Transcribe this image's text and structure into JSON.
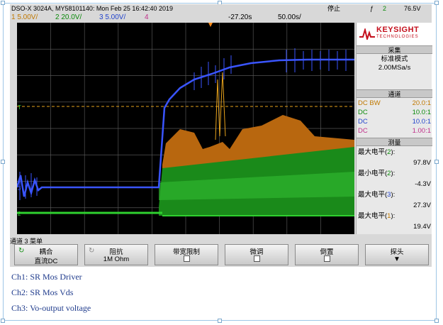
{
  "status": {
    "model": "DSO-X 3024A, MY58101140: Mon Feb 25 16:42:40 2019",
    "run_state": "停止",
    "trigger_icon": "rising-edge",
    "trigger_channel": "2",
    "trigger_level": "76.5V"
  },
  "scales": {
    "ch1": "1  5.00V/",
    "ch2": "2  20.0V/",
    "ch3": "3  5.00V/",
    "ch4": "4",
    "time_delay": "-27.20s",
    "time_div": "50.00s/"
  },
  "colors": {
    "ch1": "#e8a31c",
    "ch2": "#20c020",
    "ch3": "#3355ff",
    "ch4": "#e040a0",
    "brand": "#c40f1c"
  },
  "panel": {
    "brand": "KEYSIGHT",
    "brand_sub": "TECHNOLOGIES",
    "acq_header": "采集",
    "acq_mode": "标准模式",
    "acq_rate": "2.00MSa/s",
    "chan_header": "通道",
    "channels": [
      {
        "coupling": "DC BW",
        "probe": "20.0:1"
      },
      {
        "coupling": "DC",
        "probe": "10.0:1"
      },
      {
        "coupling": "DC",
        "probe": "10.0:1"
      },
      {
        "coupling": "DC",
        "probe": "1.00:1"
      }
    ],
    "meas_header": "测量",
    "measurements": [
      {
        "label": "最大电平(",
        "ch": "2",
        "close": "):",
        "value": "97.8V"
      },
      {
        "label": "最小电平(",
        "ch": "2",
        "close": "):",
        "value": "-4.3V"
      },
      {
        "label": "最大电平(",
        "ch": "3",
        "close": "):",
        "value": "27.3V"
      },
      {
        "label": "最大电平(",
        "ch": "1",
        "close": "):",
        "value": "19.4V"
      }
    ]
  },
  "softkeys": {
    "menu_label": "通道 3 菜单",
    "coupling_title": "耦合",
    "coupling_value": "直流DC",
    "impedance_title": "阻抗",
    "impedance_value": "1M Ohm",
    "bw_limit_title": "带宽限制",
    "fine_title": "微调",
    "invert_title": "倒置",
    "probe_title": "探头"
  },
  "captions": [
    "Ch1: SR Mos Driver",
    "Ch2: SR Mos Vds",
    "Ch3: Vo-output voltage"
  ]
}
